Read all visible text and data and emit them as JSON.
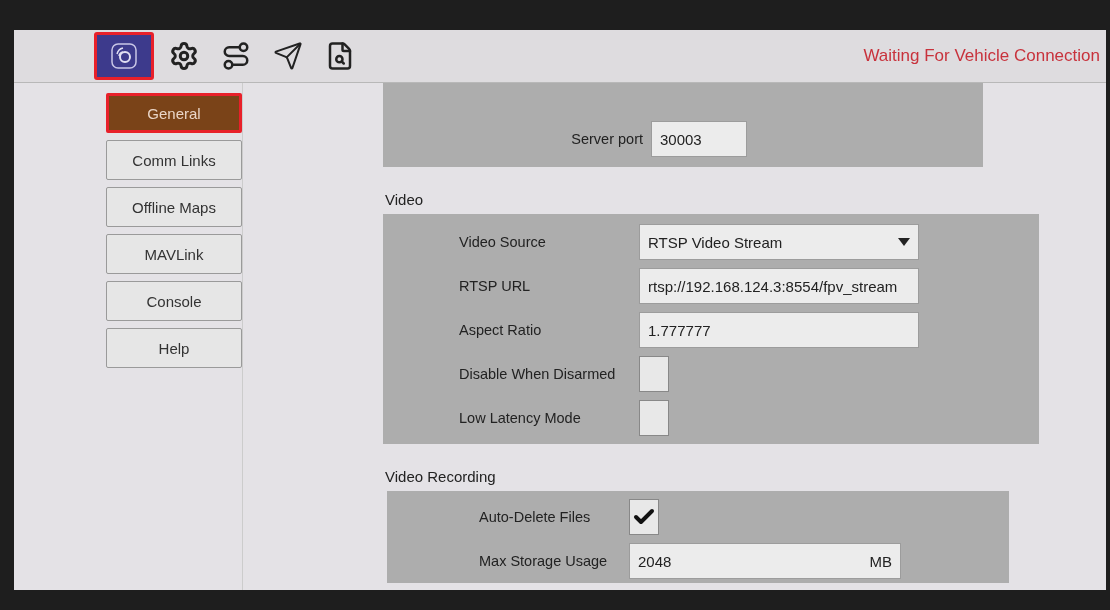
{
  "toolbar": {
    "items": [
      {
        "kind": "logo",
        "selected": true,
        "highlighted": true
      },
      {
        "kind": "settings",
        "selected": false,
        "highlighted": false
      },
      {
        "kind": "route",
        "selected": false,
        "highlighted": false
      },
      {
        "kind": "plane",
        "selected": false,
        "highlighted": false
      },
      {
        "kind": "document",
        "selected": false,
        "highlighted": false
      }
    ],
    "status": "Waiting For Vehicle Connection"
  },
  "sidebar": {
    "items": [
      {
        "label": "General",
        "selected": true,
        "highlighted": true
      },
      {
        "label": "Comm Links",
        "selected": false,
        "highlighted": false
      },
      {
        "label": "Offline Maps",
        "selected": false,
        "highlighted": false
      },
      {
        "label": "MAVLink",
        "selected": false,
        "highlighted": false
      },
      {
        "label": "Console",
        "selected": false,
        "highlighted": false
      },
      {
        "label": "Help",
        "selected": false,
        "highlighted": false
      }
    ]
  },
  "sections": [
    {
      "rows": [
        {
          "kind": "text",
          "label": "Server port",
          "value": "30003"
        }
      ]
    },
    {
      "title": "Video",
      "rows": [
        {
          "kind": "select",
          "label": "Video Source",
          "value": "RTSP Video Stream"
        },
        {
          "kind": "text",
          "label": "RTSP URL",
          "value": "rtsp://192.168.124.3:8554/fpv_stream"
        },
        {
          "kind": "text",
          "label": "Aspect Ratio",
          "value": "1.777777"
        },
        {
          "kind": "checkbox",
          "label": "Disable When Disarmed",
          "checked": false
        },
        {
          "kind": "checkbox",
          "label": "Low Latency Mode",
          "checked": false
        }
      ]
    },
    {
      "title": "Video Recording",
      "rows": [
        {
          "kind": "checkbox",
          "label": "Auto-Delete Files",
          "checked": true
        },
        {
          "kind": "text",
          "label": "Max Storage Usage",
          "value": "2048",
          "unit": "MB"
        }
      ]
    }
  ]
}
